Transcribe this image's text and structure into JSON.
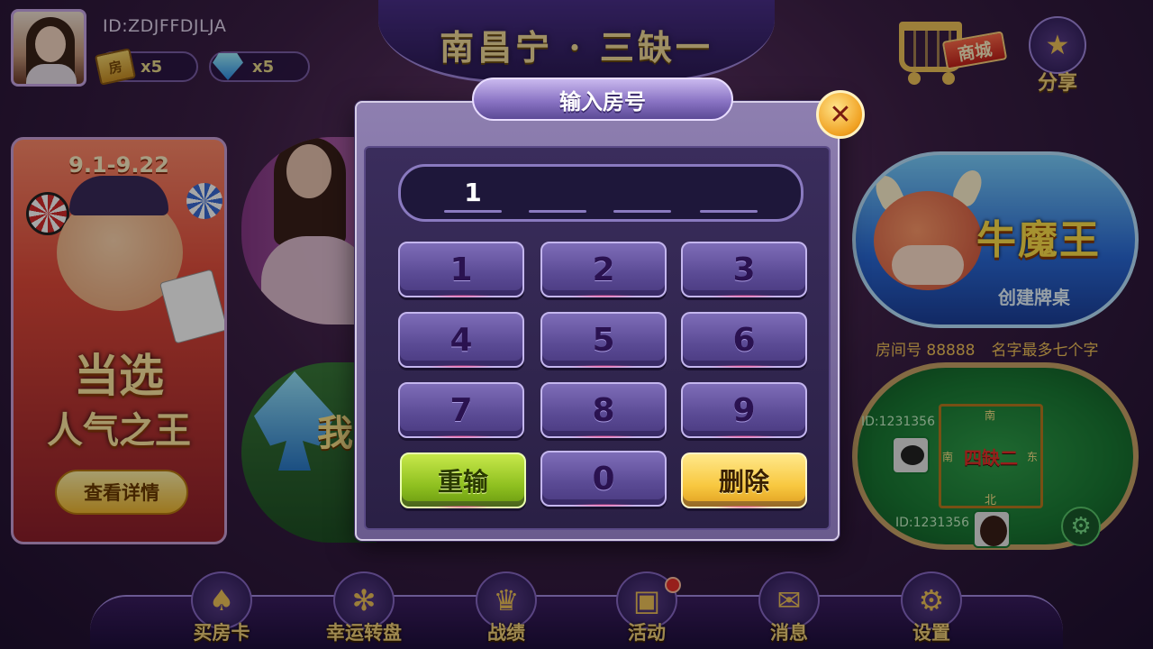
{
  "player": {
    "id_label": "ID:ZDJFFDJLJA",
    "room_cards": "x5",
    "card_icon_text": "房",
    "diamonds": "x5"
  },
  "header": {
    "title": "南昌宁 · 三缺一",
    "shop_label": "商城",
    "share_label": "分享"
  },
  "promo": {
    "date": "9.1-9.22",
    "slogan_line1": "当选",
    "slogan_line2": "人气之王",
    "button": "查看详情"
  },
  "mid": {
    "banner_text": "我"
  },
  "right": {
    "game_title": "牛魔王",
    "game_sub": "创建牌桌",
    "room_info": "房间号 88888",
    "name_hint": "名字最多七个字",
    "table": {
      "center_label": "四缺二",
      "north": "北",
      "south": "南",
      "east": "东",
      "west": "西",
      "seat1_id": "ID:1231356",
      "seat2_id": "ID:1231356"
    }
  },
  "modal": {
    "title": "输入房号",
    "close": "✕",
    "input_slots": [
      "1",
      "",
      "",
      ""
    ],
    "keys": [
      "1",
      "2",
      "3",
      "4",
      "5",
      "6",
      "7",
      "8",
      "9"
    ],
    "reset_label": "重输",
    "zero_label": "0",
    "delete_label": "删除"
  },
  "nav": [
    {
      "label": "买房卡",
      "icon": "card-icon"
    },
    {
      "label": "幸运转盘",
      "icon": "wheel-icon"
    },
    {
      "label": "战绩",
      "icon": "crown-icon"
    },
    {
      "label": "活动",
      "icon": "gift-icon"
    },
    {
      "label": "消息",
      "icon": "mail-icon"
    },
    {
      "label": "设置",
      "icon": "gear-icon"
    }
  ],
  "colors": {
    "accent_gold": "#f3d27a",
    "panel_purple": "#5a4a94",
    "reset_green": "#8fc020",
    "delete_yellow": "#f8c840"
  }
}
